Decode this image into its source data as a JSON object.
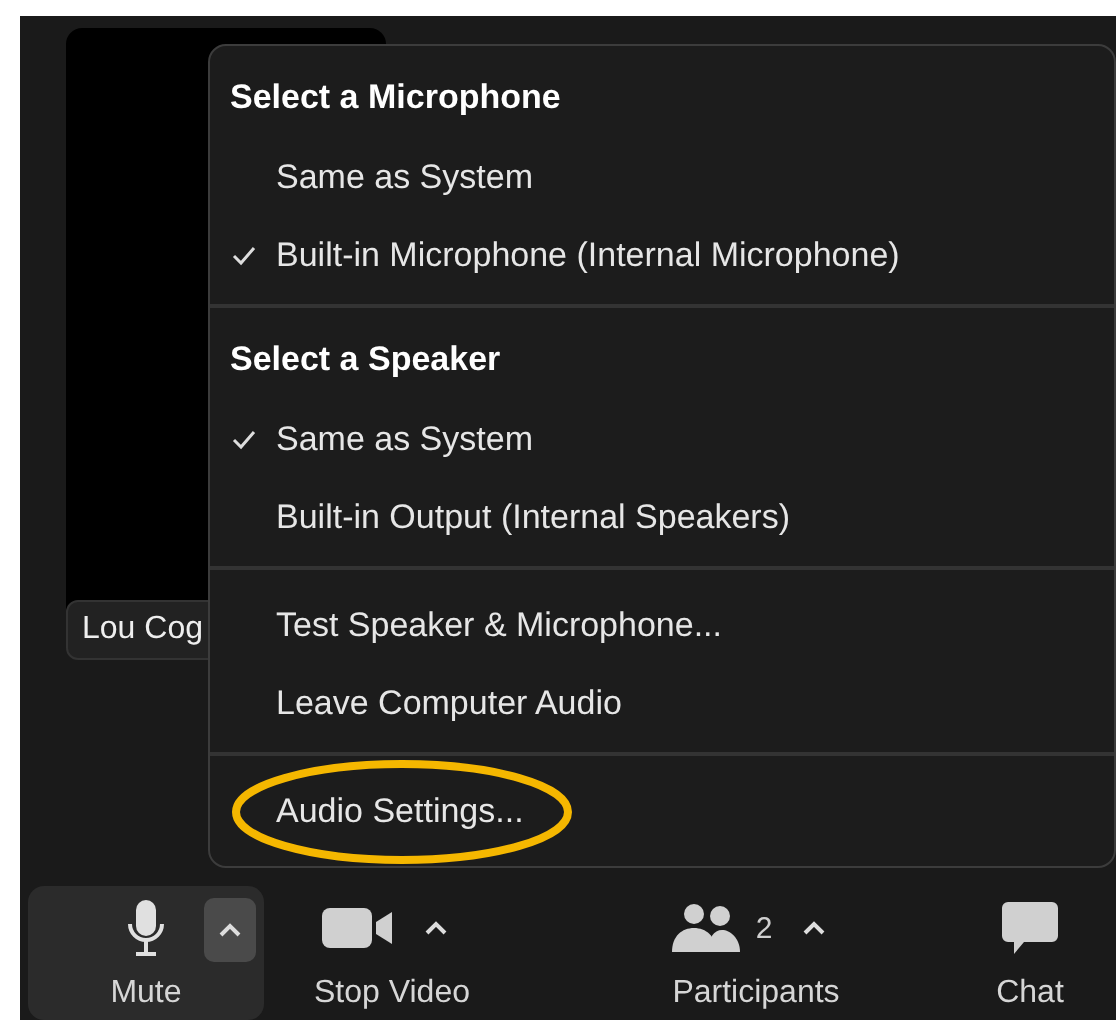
{
  "video_tile": {
    "name": "Lou Cog"
  },
  "menu": {
    "sections": [
      {
        "heading": "Select a Microphone",
        "items": [
          {
            "label": "Same as System",
            "checked": false,
            "annotated": false
          },
          {
            "label": "Built-in Microphone (Internal Microphone)",
            "checked": true,
            "annotated": false
          }
        ]
      },
      {
        "heading": "Select a Speaker",
        "items": [
          {
            "label": "Same as System",
            "checked": true,
            "annotated": false
          },
          {
            "label": "Built-in Output (Internal Speakers)",
            "checked": false,
            "annotated": false
          }
        ]
      },
      {
        "items": [
          {
            "label": "Test Speaker & Microphone...",
            "checked": false,
            "annotated": false
          },
          {
            "label": "Leave Computer Audio",
            "checked": false,
            "annotated": false
          }
        ]
      },
      {
        "items": [
          {
            "label": "Audio Settings...",
            "checked": false,
            "annotated": true
          }
        ]
      }
    ]
  },
  "toolbar": [
    {
      "kind": "mic",
      "label": "Mute",
      "caret": true,
      "selected": true
    },
    {
      "kind": "video",
      "label": "Stop Video",
      "caret": true,
      "selected": false
    },
    {
      "kind": "participants",
      "label": "Participants",
      "count": "2",
      "caret": true,
      "selected": false
    },
    {
      "kind": "chat",
      "label": "Chat",
      "caret": false,
      "selected": false
    }
  ]
}
